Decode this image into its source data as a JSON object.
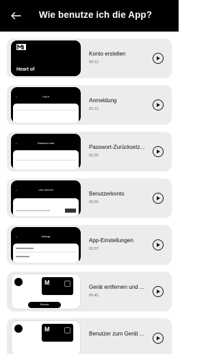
{
  "header": {
    "title": "Wie benutze ich die App?",
    "back_icon": "arrow-left-icon"
  },
  "items": [
    {
      "title": "Konto erstellen",
      "duration": "00:12",
      "thumb_text": "Heart of"
    },
    {
      "title": "Anmeldung",
      "duration": "01:12",
      "thumb_text": "Log in"
    },
    {
      "title": "Passwort-Zurücksetz...",
      "duration": "01:30",
      "thumb_text": "Password reset"
    },
    {
      "title": "Benutzerkonto",
      "duration": "00:35",
      "thumb_text": "User account"
    },
    {
      "title": "App-Einstellungen",
      "duration": "01:07",
      "thumb_text": "Settings"
    },
    {
      "title": "Gerät entfernen und ...",
      "duration": "00:45",
      "thumb_text": "Remove"
    },
    {
      "title": "Benutzer zum Gerät ...",
      "duration": "",
      "thumb_text": ""
    }
  ]
}
